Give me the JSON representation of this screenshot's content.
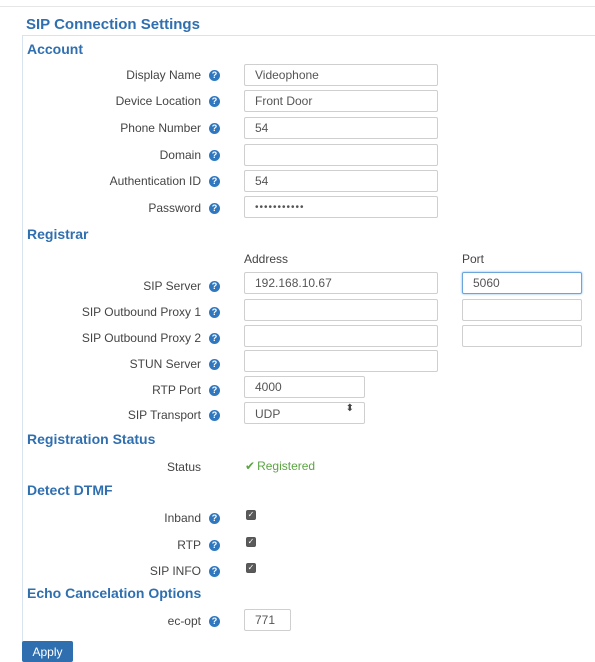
{
  "page": {
    "title": "SIP Connection Settings",
    "apply_label": "Apply",
    "help_glyph": "?"
  },
  "account": {
    "heading": "Account",
    "display_name": {
      "label": "Display Name",
      "value": "Videophone"
    },
    "device_location": {
      "label": "Device Location",
      "value": "Front Door"
    },
    "phone_number": {
      "label": "Phone Number",
      "value": "54"
    },
    "domain": {
      "label": "Domain",
      "value": ""
    },
    "auth_id": {
      "label": "Authentication ID",
      "value": "54"
    },
    "password": {
      "label": "Password",
      "value": "•••••••••••"
    }
  },
  "registrar": {
    "heading": "Registrar",
    "address_header": "Address",
    "port_header": "Port",
    "sip_server": {
      "label": "SIP Server",
      "address": "192.168.10.67",
      "port": "5060"
    },
    "outbound_proxy_1": {
      "label": "SIP Outbound Proxy 1",
      "address": "",
      "port": ""
    },
    "outbound_proxy_2": {
      "label": "SIP Outbound Proxy 2",
      "address": "",
      "port": ""
    },
    "stun_server": {
      "label": "STUN Server",
      "address": ""
    },
    "rtp_port": {
      "label": "RTP Port",
      "value": "4000"
    },
    "sip_transport": {
      "label": "SIP Transport",
      "value": "UDP",
      "caret": "⬍"
    }
  },
  "registration_status": {
    "heading": "Registration Status",
    "status_label": "Status",
    "status_value": "Registered",
    "status_check": "✔",
    "status_color": "#5aa541"
  },
  "detect_dtmf": {
    "heading": "Detect DTMF",
    "inband": {
      "label": "Inband",
      "checked": true
    },
    "rtp": {
      "label": "RTP",
      "checked": true
    },
    "sip_info": {
      "label": "SIP INFO",
      "checked": true
    },
    "check_glyph": "✓"
  },
  "echo_cancel": {
    "heading": "Echo Cancelation Options",
    "ec_opt": {
      "label": "ec-opt",
      "value": "771"
    }
  },
  "colors": {
    "accent": "#2f6fb0",
    "help_icon": "#2f78c0"
  }
}
